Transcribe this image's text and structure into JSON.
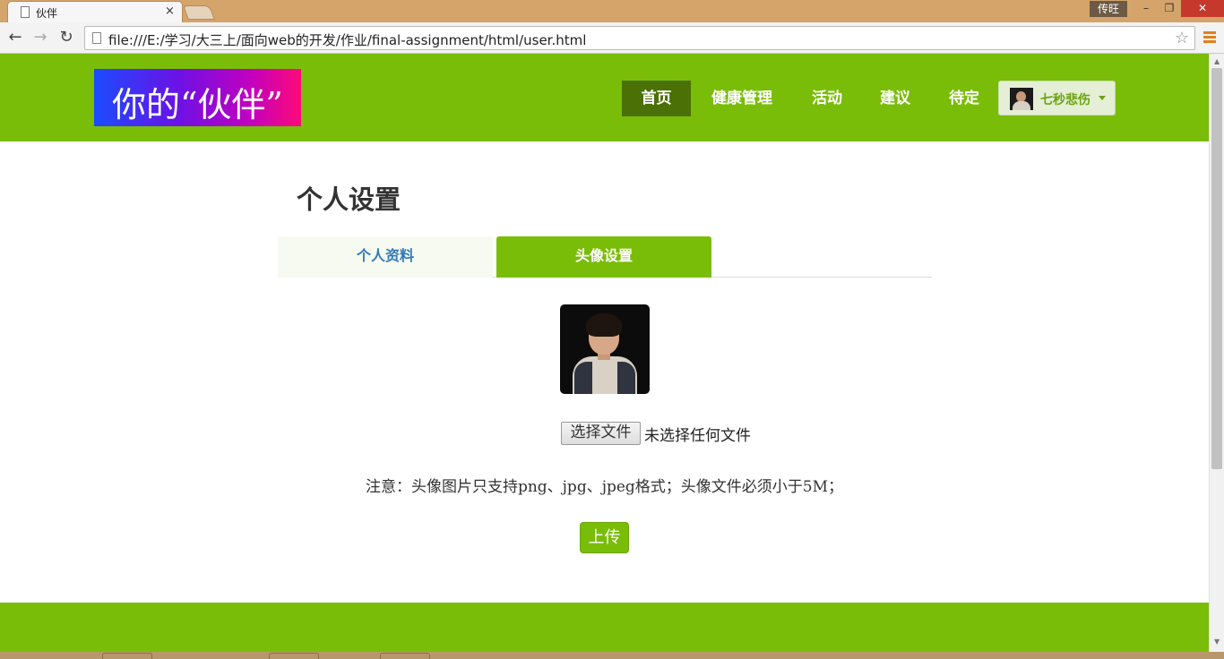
{
  "browser": {
    "tab_title": "伙伴",
    "tab_close": "×",
    "user_badge": "传旺",
    "url": "file:///E:/学习/大三上/面向web的开发/作业/final-assignment/html/user.html",
    "window_controls": {
      "minimize": "–",
      "maximize": "❐",
      "close": "✕"
    },
    "nav": {
      "back": "←",
      "forward": "→",
      "reload": "↻",
      "star": "☆"
    }
  },
  "header": {
    "logo_text": "你的“伙伴”",
    "nav": [
      {
        "label": "首页",
        "active": true
      },
      {
        "label": "健康管理"
      },
      {
        "label": "活动"
      },
      {
        "label": "建议"
      },
      {
        "label": "待定"
      }
    ],
    "user": {
      "name": "七秒悲伤"
    }
  },
  "main": {
    "title": "个人设置",
    "tabs": [
      {
        "label": "个人资料",
        "active": false
      },
      {
        "label": "头像设置",
        "active": true
      }
    ],
    "file_input": {
      "button_label": "选择文件",
      "status": "未选择任何文件"
    },
    "note": "注意：头像图片只支持png、jpg、jpeg格式；头像文件必须小于5M；",
    "upload_label": "上传"
  },
  "colors": {
    "brand_green": "#79bd08",
    "active_nav": "#4a7006",
    "link_blue": "#337ab7"
  }
}
